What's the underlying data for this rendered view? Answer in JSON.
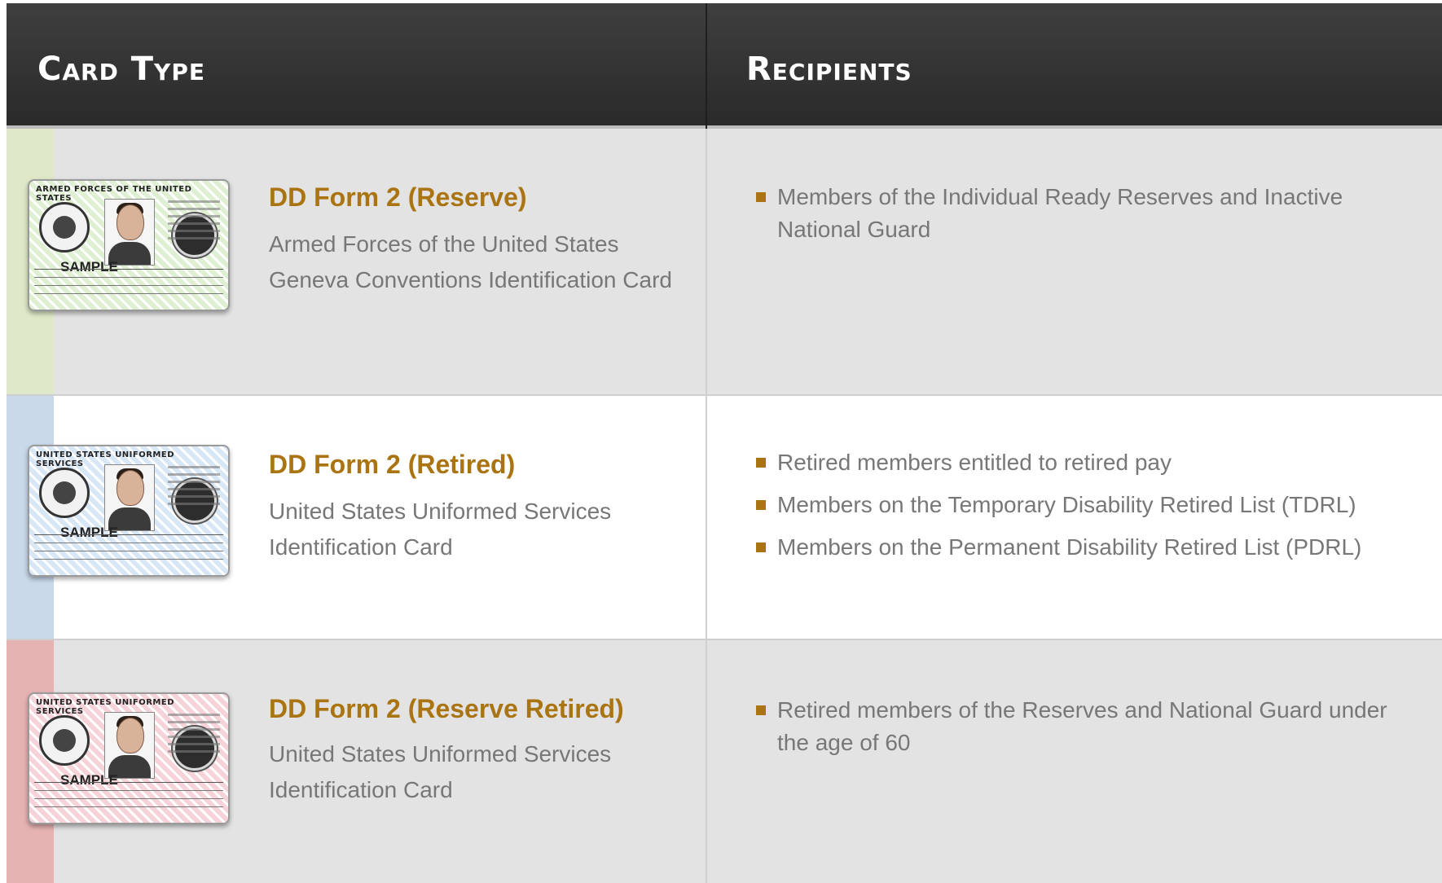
{
  "header": {
    "card_type": "Card Type",
    "recipients": "Recipients"
  },
  "rows": [
    {
      "title": "DD Form 2 (Reserve)",
      "description": "Armed Forces of the United States Geneva Conventions Identification Card",
      "card_header": "Armed Forces of the United States",
      "card_sample": "SAMPLE",
      "stripe_color": "#dfe9c9",
      "card_tint": "#dff0d2",
      "background": "#e3e3e3",
      "recipients": [
        "Members of the Individual Ready Reserves and Inactive National Guard"
      ]
    },
    {
      "title": "DD Form 2 (Retired)",
      "description": "United States Uniformed Services Identification Card",
      "card_header": "United States Uniformed Services",
      "card_sample": "SAMPLE",
      "stripe_color": "#c9d9ea",
      "card_tint": "#d8e7f6",
      "background": "#ffffff",
      "recipients": [
        "Retired members entitled to retired pay",
        "Members on the Temporary Disability Retired List (TDRL)",
        "Members on the Permanent Disability Retired List (PDRL)"
      ]
    },
    {
      "title": "DD Form 2 (Reserve Retired)",
      "description": "United States Uniformed Services Identification Card",
      "card_header": "United States Uniformed Services",
      "card_sample": "SAMPLE",
      "stripe_color": "#e6b3b3",
      "card_tint": "#f6d3d9",
      "background": "#e3e3e3",
      "recipients": [
        "Retired members of the Reserves and National Guard under the age of 60"
      ]
    }
  ],
  "colors": {
    "accent": "#a97411",
    "header_bg": "#333333",
    "body_text": "#777777"
  }
}
